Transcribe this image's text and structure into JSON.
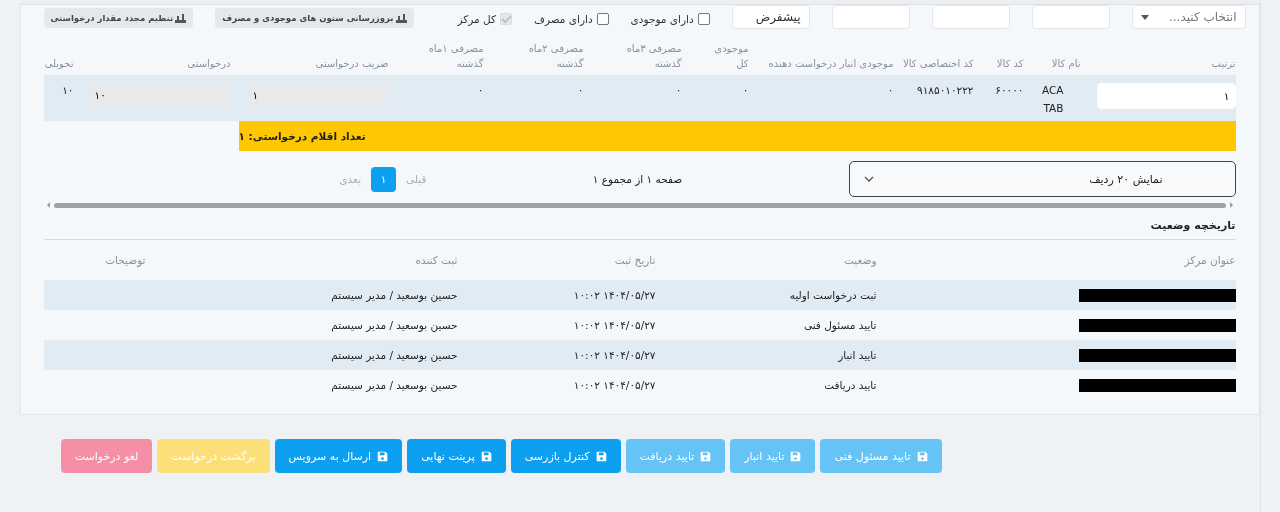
{
  "filters": {
    "fields": [
      {
        "kind": "select",
        "placeholder": "انتخاب کنید..."
      },
      {
        "kind": "text"
      },
      {
        "kind": "text"
      },
      {
        "kind": "text"
      },
      {
        "kind": "text",
        "value": "پیشفرض"
      }
    ],
    "checkboxes": [
      {
        "label": "دارای موجودی",
        "checked": false,
        "disabled": false
      },
      {
        "label": "دارای مصرف",
        "checked": false,
        "disabled": false
      },
      {
        "label": "کل مرکز",
        "checked": true,
        "disabled": true
      }
    ],
    "tools": [
      "بروزرسانی ستون های موجودی و مصرف",
      "تنظیم مجدد مقدار درخواستی"
    ]
  },
  "items": {
    "columns": [
      "ترتیب",
      "نام کالا",
      "کد کالا",
      "کد اختصاصی کالا",
      "موجودی انبار درخواست دهنده",
      "موجودی کل",
      "مصرفی ۳ماه گذشته",
      "مصرفی ۲ماه گذشته",
      "مصرفی ۱ماه گذشته",
      "ضریب درخواستی",
      "درخواستی",
      "تحویلی"
    ],
    "rows": [
      [
        {
          "kind": "input",
          "value": "۱"
        },
        {
          "kind": "text",
          "value": "ACA TAB"
        },
        {
          "kind": "text",
          "value": "۶۰۰۰۰"
        },
        {
          "kind": "text",
          "value": "۹۱۸۵۰۱۰۲۲۲"
        },
        {
          "kind": "text",
          "value": "۰"
        },
        {
          "kind": "text",
          "value": "۰"
        },
        {
          "kind": "text",
          "value": "۰"
        },
        {
          "kind": "text",
          "value": "۰"
        },
        {
          "kind": "text",
          "value": "۰"
        },
        {
          "kind": "readonly",
          "value": "۱"
        },
        {
          "kind": "readonly",
          "value": "۱۰"
        },
        {
          "kind": "text",
          "value": "۱۰"
        }
      ]
    ],
    "summary": "تعداد اقلام درخواستی: ۱"
  },
  "pager": {
    "page_size": "نمایش ۲۰ ردیف",
    "info": "صفحه ۱ از مجموع ۱",
    "prev": "قبلی",
    "pages": [
      {
        "label": "۱",
        "selected": true
      }
    ],
    "next": "بعدی"
  },
  "history": {
    "title": "تاریخچه وضعیت",
    "columns": [
      "عنوان مرکز",
      "وضعیت",
      "تاریخ ثبت",
      "ثبت کننده",
      "توضیحات"
    ],
    "rows": [
      {
        "center_redacted": true,
        "status": "ثبت درخواست اولیه",
        "date": "۱۴۰۴/۰۵/۲۷ ۱۰:۰۲",
        "by": "حسین بوسعید / مدیر سیستم"
      },
      {
        "center_redacted": true,
        "status": "تایید مسئول فنی",
        "date": "۱۴۰۴/۰۵/۲۷ ۱۰:۰۲",
        "by": "حسین بوسعید / مدیر سیستم"
      },
      {
        "center_redacted": true,
        "status": "تایید انبار",
        "date": "۱۴۰۴/۰۵/۲۷ ۱۰:۰۲",
        "by": "حسین بوسعید / مدیر سیستم"
      },
      {
        "center_redacted": true,
        "status": "تایید دریافت",
        "date": "۱۴۰۴/۰۵/۲۷ ۱۰:۰۲",
        "by": "حسین بوسعید / مدیر سیستم"
      }
    ]
  },
  "actions": [
    {
      "label": "تایید مسئول فنی",
      "kind": "primary",
      "disabled": true
    },
    {
      "label": "تایید انبار",
      "kind": "primary",
      "disabled": true
    },
    {
      "label": "تایید دریافت",
      "kind": "primary",
      "disabled": true
    },
    {
      "label": "کنترل بازرسی",
      "kind": "primary",
      "disabled": false
    },
    {
      "label": "پرینت نهایی",
      "kind": "primary",
      "disabled": false
    },
    {
      "label": "ارسال به سرویس",
      "kind": "primary",
      "disabled": false
    },
    {
      "label": "برگشت درخواست",
      "kind": "warning",
      "disabled": true
    },
    {
      "label": "لغو درخواست",
      "kind": "danger",
      "disabled": true
    }
  ]
}
